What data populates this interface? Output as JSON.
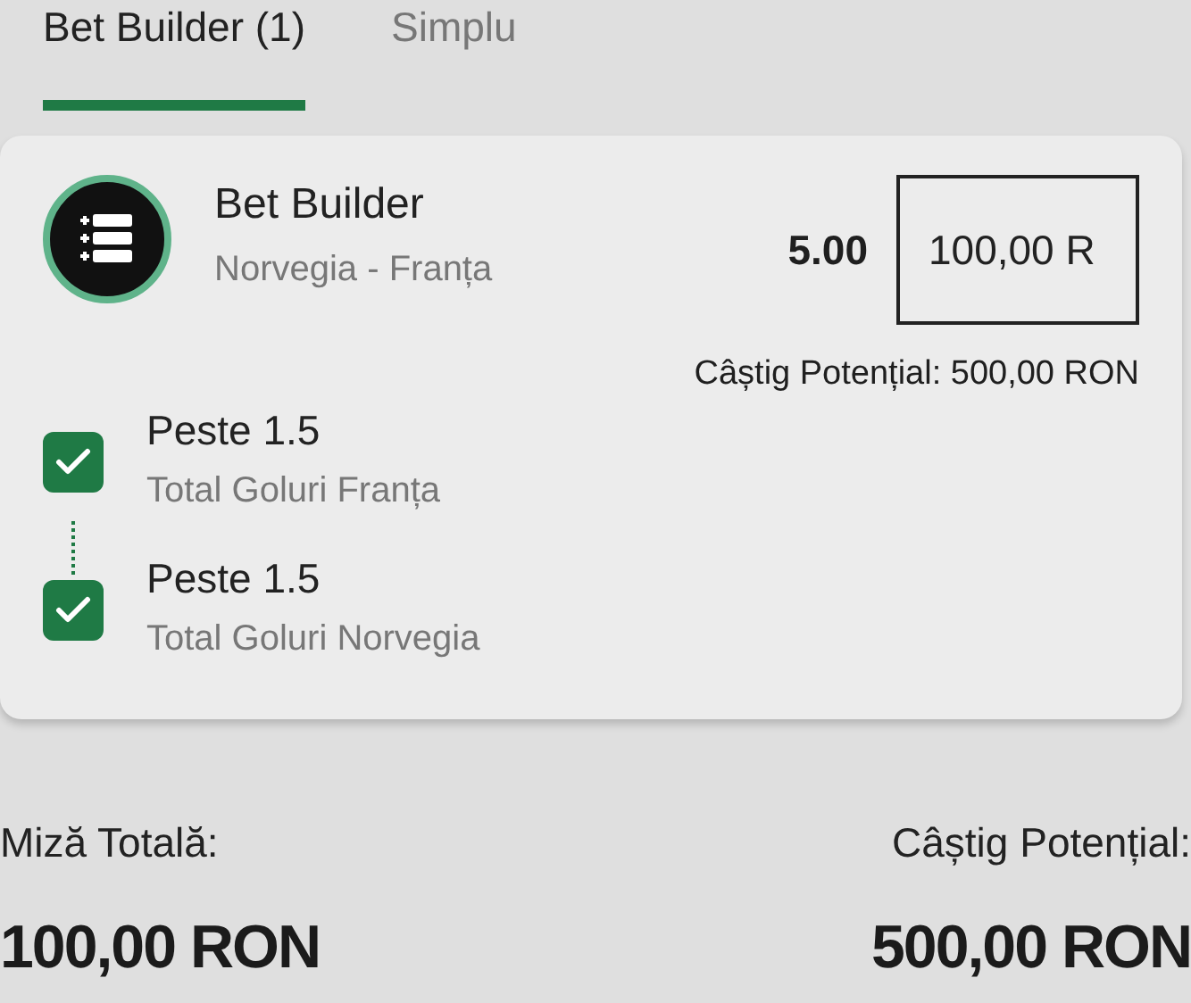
{
  "tabs": [
    {
      "label": "Bet Builder (1)",
      "selected": true
    },
    {
      "label": "Simplu",
      "selected": false
    }
  ],
  "bet": {
    "title": "Bet Builder",
    "match": "Norvegia - Franța",
    "odds": "5.00",
    "stake": "100,00 R",
    "potential_win": "Câștig Potențial: 500,00 RON",
    "selections": [
      {
        "pick": "Peste 1.5",
        "market": "Total Goluri Franța",
        "checked": true
      },
      {
        "pick": "Peste 1.5",
        "market": "Total Goluri Norvegia",
        "checked": true
      }
    ]
  },
  "summary": {
    "total_stake_label": "Miză Totală:",
    "total_stake": "100,00 RON",
    "potential_win_label": "Câștig Potențial:",
    "potential_win": "500,00 RON"
  }
}
